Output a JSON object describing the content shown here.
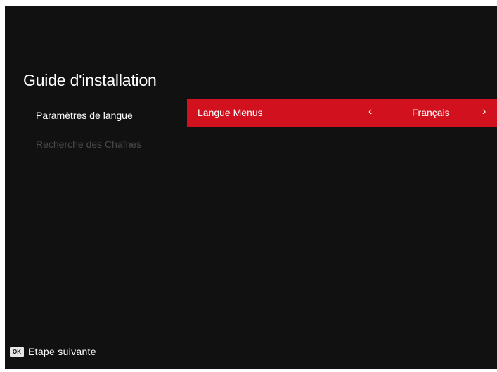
{
  "header": {
    "title": "Guide d'installation"
  },
  "sidebar": {
    "items": [
      {
        "label": "Paramètres de langue",
        "state": "active"
      },
      {
        "label": "Recherche des Chaînes",
        "state": "inactive"
      }
    ]
  },
  "setting": {
    "label": "Langue Menus",
    "value": "Français",
    "prev_glyph": "‹",
    "next_glyph": "›"
  },
  "footer": {
    "key_label": "OK",
    "action_label": "Etape suivante"
  },
  "colors": {
    "background": "#111111",
    "highlight": "#d2111f",
    "inactive_text": "#4a4a4a"
  }
}
